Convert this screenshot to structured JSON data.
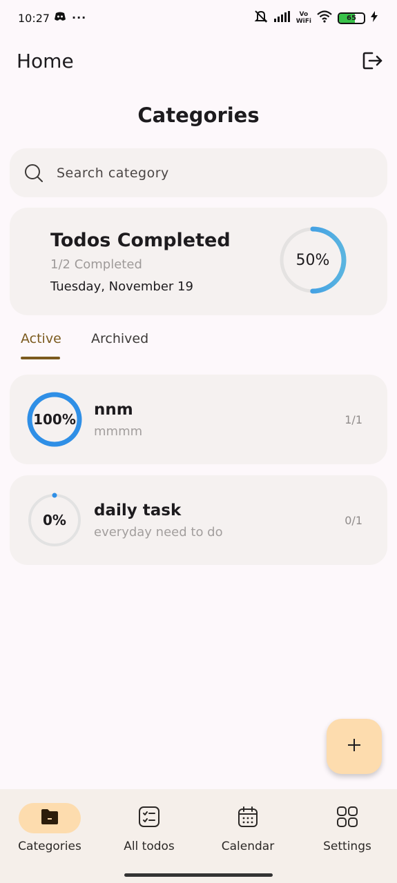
{
  "status_bar": {
    "time": "10:27",
    "battery": "65",
    "battery_level": 0.65,
    "vowifi_top": "Vo",
    "vowifi_bottom": "WiFi",
    "icons": [
      "discord-icon",
      "more-dots-icon",
      "mute-icon",
      "signal-icon",
      "wifi-icon",
      "battery-icon",
      "charging-icon"
    ]
  },
  "header": {
    "title": "Home",
    "logout_icon": "logout-icon"
  },
  "main": {
    "section_title": "Categories",
    "search": {
      "placeholder": "Search category",
      "icon": "search-icon"
    },
    "summary": {
      "title": "Todos Completed",
      "subtitle": "1/2 Completed",
      "date": "Tuesday, November 19",
      "percent_label": "50%",
      "progress": 0.5
    },
    "tabs": [
      {
        "label": "Active",
        "active": true
      },
      {
        "label": "Archived",
        "active": false
      }
    ],
    "categories": [
      {
        "name": "nnm",
        "description": "mmmm",
        "percent_label": "100%",
        "progress": 1.0,
        "count": "1/1"
      },
      {
        "name": "daily task",
        "description": "everyday need to do",
        "percent_label": "0%",
        "progress": 0.0,
        "count": "0/1"
      }
    ]
  },
  "fab": {
    "icon": "plus-icon"
  },
  "bottom_nav": {
    "items": [
      {
        "label": "Categories",
        "icon": "folder-icon",
        "active": true
      },
      {
        "label": "All todos",
        "icon": "checklist-icon",
        "active": false
      },
      {
        "label": "Calendar",
        "icon": "calendar-icon",
        "active": false
      },
      {
        "label": "Settings",
        "icon": "grid-icon",
        "active": false
      }
    ]
  },
  "colors": {
    "background": "#fdf8fb",
    "card": "#f5f1f0",
    "accent": "#7b5a1e",
    "fab": "#fddcae",
    "ring_blue": "#2f8fe6",
    "ring_track": "#e2e2e2"
  }
}
